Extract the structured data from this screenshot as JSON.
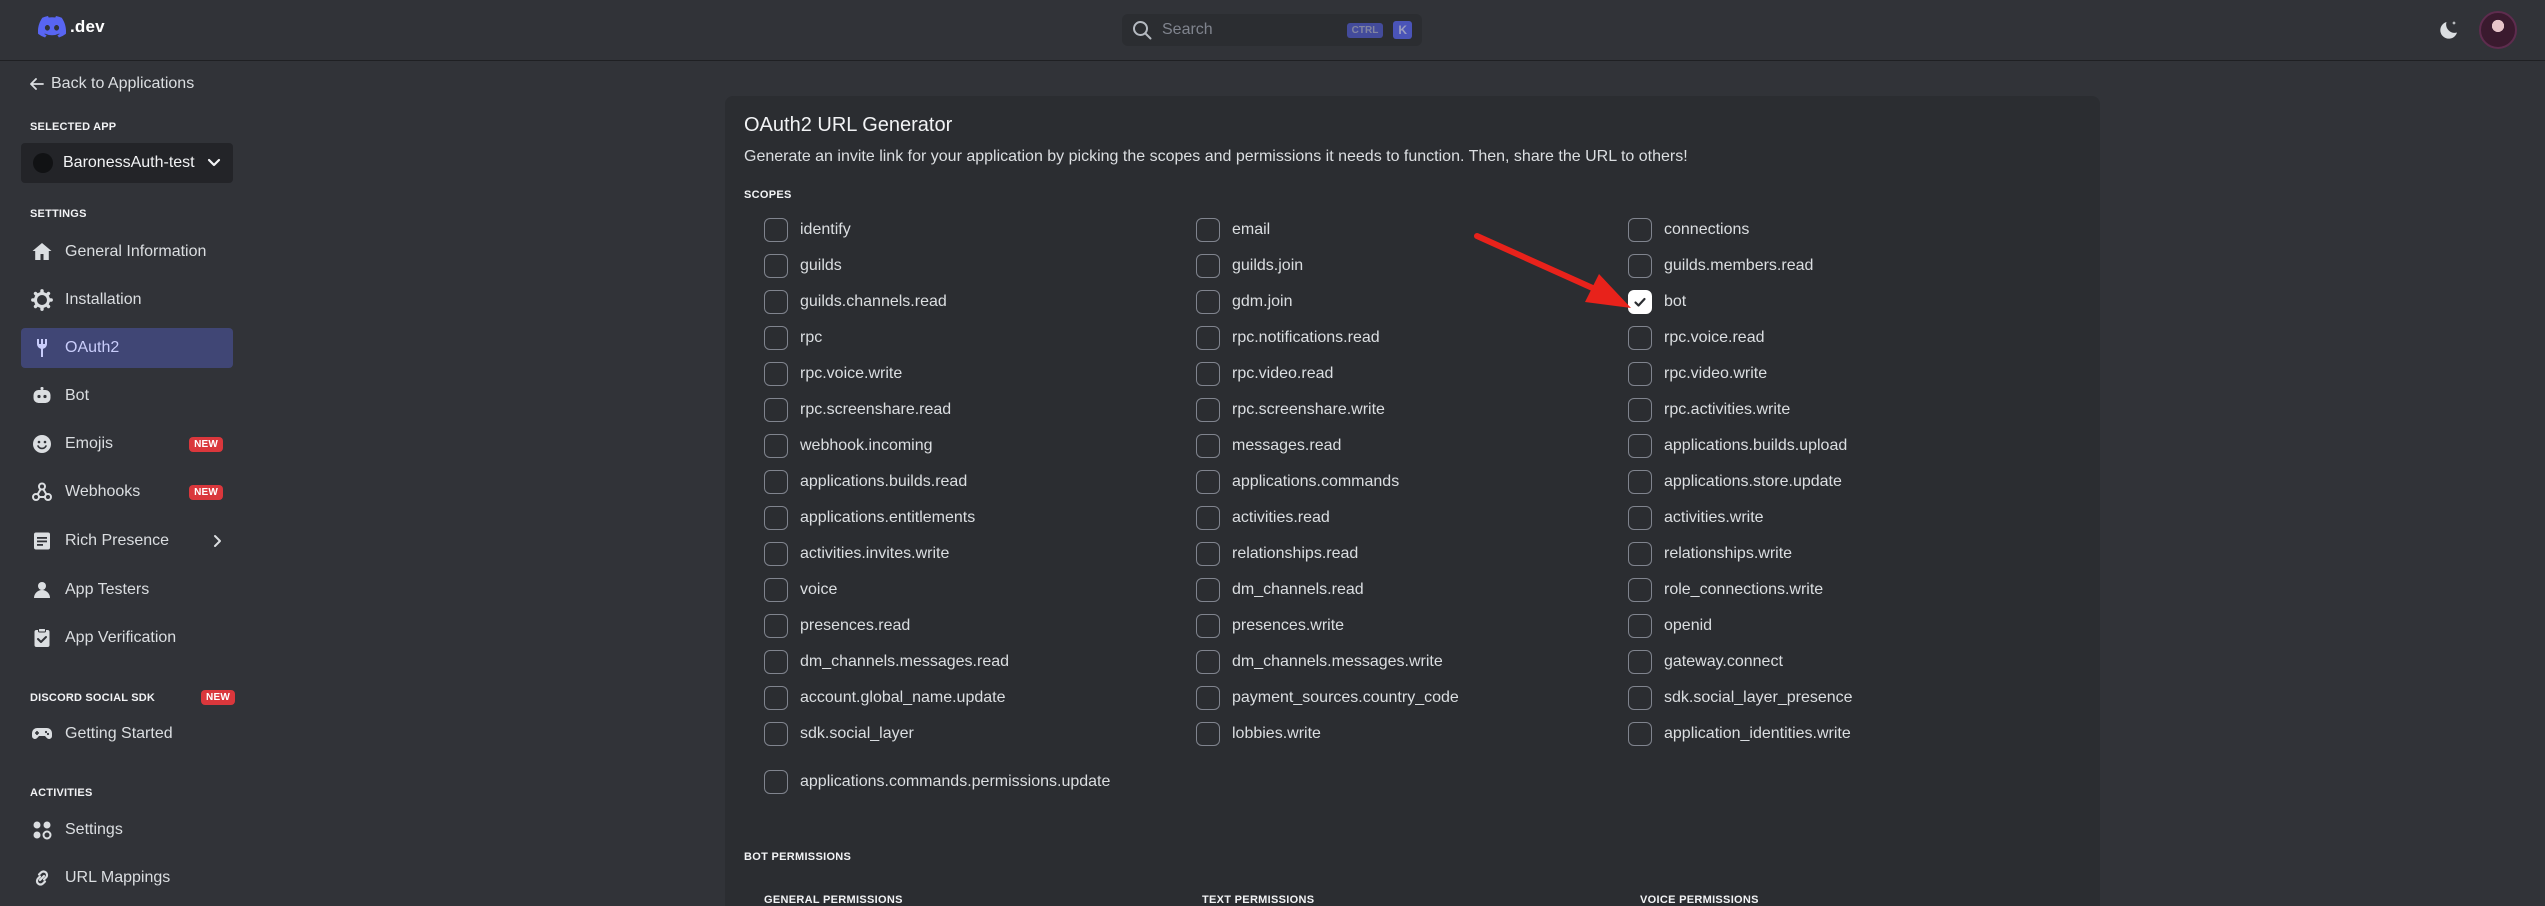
{
  "topbar": {
    "logo_text": ".dev",
    "search_placeholder": "Search",
    "shortcut_ctrl": "CTRL",
    "shortcut_key": "K"
  },
  "sidebar": {
    "back_label": "Back to Applications",
    "selected_app_label": "SELECTED APP",
    "app_name": "BaronessAuth-test",
    "settings_label": "SETTINGS",
    "settings_items": [
      {
        "label": "General Information",
        "icon": "home-icon"
      },
      {
        "label": "Installation",
        "icon": "gear-icon"
      },
      {
        "label": "OAuth2",
        "icon": "wrench-icon",
        "active": true
      },
      {
        "label": "Bot",
        "icon": "robot-icon"
      },
      {
        "label": "Emojis",
        "icon": "smile-icon",
        "badge": "NEW"
      },
      {
        "label": "Webhooks",
        "icon": "webhook-icon",
        "badge": "NEW"
      },
      {
        "label": "Rich Presence",
        "icon": "document-icon"
      },
      {
        "label": "App Testers",
        "icon": "person-icon"
      },
      {
        "label": "App Verification",
        "icon": "check-clipboard-icon"
      }
    ],
    "sdk_label": "DISCORD SOCIAL SDK",
    "sdk_badge": "NEW",
    "sdk_items": [
      {
        "label": "Getting Started",
        "icon": "gamepad-icon"
      }
    ],
    "activities_label": "ACTIVITIES",
    "activities_items": [
      {
        "label": "Settings",
        "icon": "activity-gear-icon"
      },
      {
        "label": "URL Mappings",
        "icon": "link-icon"
      }
    ]
  },
  "main": {
    "title": "OAuth2 URL Generator",
    "description": "Generate an invite link for your application by picking the scopes and permissions it needs to function. Then, share the URL to others!",
    "scopes_label": "SCOPES",
    "scopes": [
      {
        "label": "identify",
        "checked": false
      },
      {
        "label": "email",
        "checked": false
      },
      {
        "label": "connections",
        "checked": false
      },
      {
        "label": "guilds",
        "checked": false
      },
      {
        "label": "guilds.join",
        "checked": false
      },
      {
        "label": "guilds.members.read",
        "checked": false
      },
      {
        "label": "guilds.channels.read",
        "checked": false
      },
      {
        "label": "gdm.join",
        "checked": false
      },
      {
        "label": "bot",
        "checked": true
      },
      {
        "label": "rpc",
        "checked": false
      },
      {
        "label": "rpc.notifications.read",
        "checked": false
      },
      {
        "label": "rpc.voice.read",
        "checked": false
      },
      {
        "label": "rpc.voice.write",
        "checked": false
      },
      {
        "label": "rpc.video.read",
        "checked": false
      },
      {
        "label": "rpc.video.write",
        "checked": false
      },
      {
        "label": "rpc.screenshare.read",
        "checked": false
      },
      {
        "label": "rpc.screenshare.write",
        "checked": false
      },
      {
        "label": "rpc.activities.write",
        "checked": false
      },
      {
        "label": "webhook.incoming",
        "checked": false
      },
      {
        "label": "messages.read",
        "checked": false
      },
      {
        "label": "applications.builds.upload",
        "checked": false
      },
      {
        "label": "applications.builds.read",
        "checked": false
      },
      {
        "label": "applications.commands",
        "checked": false
      },
      {
        "label": "applications.store.update",
        "checked": false
      },
      {
        "label": "applications.entitlements",
        "checked": false
      },
      {
        "label": "activities.read",
        "checked": false
      },
      {
        "label": "activities.write",
        "checked": false
      },
      {
        "label": "activities.invites.write",
        "checked": false
      },
      {
        "label": "relationships.read",
        "checked": false
      },
      {
        "label": "relationships.write",
        "checked": false
      },
      {
        "label": "voice",
        "checked": false
      },
      {
        "label": "dm_channels.read",
        "checked": false
      },
      {
        "label": "role_connections.write",
        "checked": false
      },
      {
        "label": "presences.read",
        "checked": false
      },
      {
        "label": "presences.write",
        "checked": false
      },
      {
        "label": "openid",
        "checked": false
      },
      {
        "label": "dm_channels.messages.read",
        "checked": false
      },
      {
        "label": "dm_channels.messages.write",
        "checked": false
      },
      {
        "label": "gateway.connect",
        "checked": false
      },
      {
        "label": "account.global_name.update",
        "checked": false
      },
      {
        "label": "payment_sources.country_code",
        "checked": false
      },
      {
        "label": "sdk.social_layer_presence",
        "checked": false
      },
      {
        "label": "sdk.social_layer",
        "checked": false
      },
      {
        "label": "lobbies.write",
        "checked": false
      },
      {
        "label": "application_identities.write",
        "checked": false
      },
      {
        "label": "applications.commands.permissions.update",
        "checked": false
      }
    ],
    "bot_permissions_label": "BOT PERMISSIONS",
    "permission_groups": [
      "GENERAL PERMISSIONS",
      "TEXT PERMISSIONS",
      "VOICE PERMISSIONS"
    ]
  },
  "colors": {
    "background": "#313338",
    "panel": "#2b2d31",
    "active_nav": "#404675",
    "badge": "#da373c",
    "annotation_arrow": "#e8221b"
  }
}
